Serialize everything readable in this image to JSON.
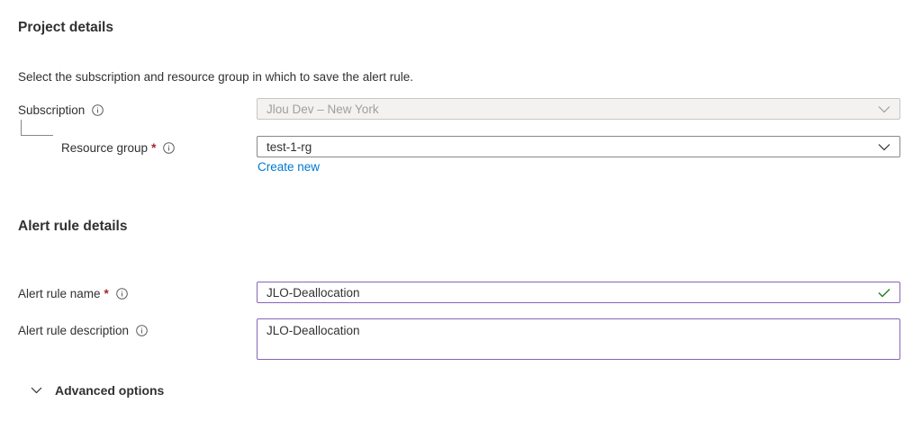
{
  "project_details": {
    "title": "Project details",
    "description": "Select the subscription and resource group in which to save the alert rule.",
    "subscription": {
      "label": "Subscription",
      "value": "Jlou Dev – New York",
      "disabled": true
    },
    "resource_group": {
      "label": "Resource group",
      "required_mark": "*",
      "value": "test-1-rg",
      "create_new_label": "Create new"
    }
  },
  "alert_rule_details": {
    "title": "Alert rule details",
    "name": {
      "label": "Alert rule name",
      "required_mark": "*",
      "value": "JLO-Deallocation",
      "valid": true
    },
    "description": {
      "label": "Alert rule description",
      "value": "JLO-Deallocation"
    }
  },
  "advanced_options": {
    "label": "Advanced options"
  },
  "icons": {
    "info": "info-icon",
    "dropdown": "chevron-down-icon",
    "valid": "checkmark-icon",
    "expand": "chevron-down-icon"
  },
  "colors": {
    "text": "#323130",
    "required": "#a4262c",
    "link": "#0078d4",
    "focus_border": "#8764b8",
    "valid_check": "#107c10",
    "disabled_bg": "#f3f2f1",
    "disabled_text": "#a19f9d"
  }
}
